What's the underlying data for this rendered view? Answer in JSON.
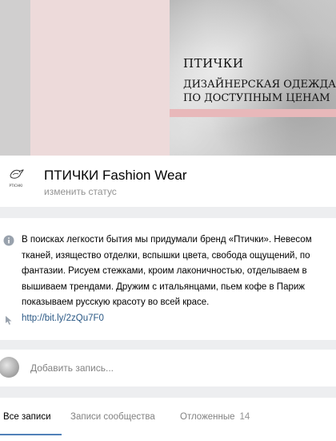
{
  "cover": {
    "title": "ПТИЧКИ",
    "subtitle_line1": "ДИЗАЙНЕРСКАЯ ОДЕЖДА",
    "subtitle_line2": "ПО ДОСТУПНЫМ ЦЕНАМ"
  },
  "header": {
    "avatar_text": "PTICHKI",
    "title": "ПТИЧКИ Fashion Wear",
    "status_link": "изменить статус"
  },
  "info": {
    "lines": [
      "В поисках легкости бытия мы придумали бренд «Птички». Невесом",
      "тканей, изящество отделки, вспышки цвета, свобода ощущений, по",
      "фантазии. Рисуем стежками, кроим лаконичностью, отделываем в",
      "вышиваем трендами. Дружим с итальянцами, пьем кофе в Париж",
      "показываем русскую красоту во всей красе."
    ],
    "link": "http://bit.ly/2zQu7F0"
  },
  "composer": {
    "placeholder": "Добавить запись..."
  },
  "tabs": {
    "all": "Все записи",
    "community": "Записи сообщества",
    "postponed": "Отложенные",
    "postponed_count": "14"
  },
  "colors": {
    "background": "#edeef0",
    "link": "#2a5885",
    "tab_active_underline": "#5181b8",
    "muted_text": "#828282"
  },
  "icons": {
    "info": "info-icon",
    "link": "link-icon",
    "logo": "bird-logo-icon"
  }
}
